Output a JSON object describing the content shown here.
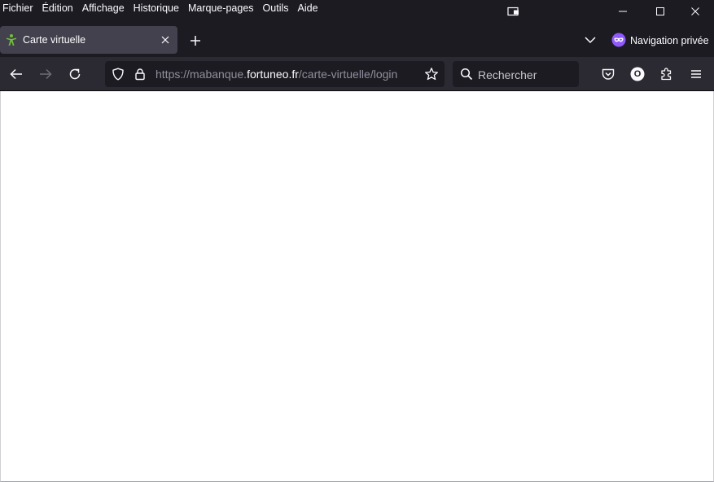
{
  "menubar": {
    "items": [
      {
        "label": "Fichier"
      },
      {
        "label": "Édition"
      },
      {
        "label": "Affichage"
      },
      {
        "label": "Historique"
      },
      {
        "label": "Marque-pages"
      },
      {
        "label": "Outils"
      },
      {
        "label": "Aide"
      }
    ]
  },
  "window_controls": {
    "icons": [
      "restore-window-icon",
      "minimize-icon",
      "maximize-icon",
      "close-icon"
    ]
  },
  "tabs": [
    {
      "title": "Carte virtuelle",
      "favicon": "green-figure-icon",
      "active": true
    }
  ],
  "tabbar": {
    "private_label": "Navigation privée"
  },
  "urlbar": {
    "prefix": "https://mabanque.",
    "domain": "fortuneo.fr",
    "path": "/carte-virtuelle/login"
  },
  "search": {
    "placeholder": "Rechercher"
  },
  "toolbar": {
    "icons": [
      "pocket-icon",
      "account-icon",
      "extensions-icon",
      "menu-icon"
    ],
    "account_letter": "O"
  },
  "colors": {
    "frame": "#1c1b22",
    "toolbar": "#2b2a33",
    "active_tab": "#42414d",
    "text": "#fbfbfe",
    "private_accent": "#9059ff",
    "favicon_green": "#6fbf3a"
  }
}
